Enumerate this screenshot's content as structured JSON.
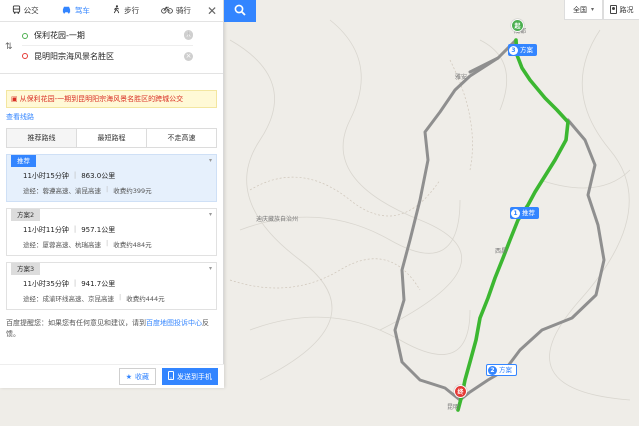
{
  "modes": {
    "transit": {
      "label": "公交",
      "icon": "bus-icon"
    },
    "drive": {
      "label": "驾车",
      "icon": "car-icon"
    },
    "walk": {
      "label": "步行",
      "icon": "walk-icon"
    },
    "bike": {
      "label": "骑行",
      "icon": "bike-icon"
    }
  },
  "origin": "保利花园-一期",
  "destination": "昆明阳宗海风景名胜区",
  "transit_notice": "从保利花园-一期到昆明阳宗海风景名胜区的跨城公交",
  "view_lines": "查看线路",
  "route_tabs": [
    "推荐路线",
    "最短路程",
    "不走高速"
  ],
  "plans": [
    {
      "tag": "推荐",
      "time": "11小时15分钟",
      "distance": "863.0公里",
      "via": "途经：蓉遵高速、渝昆高速",
      "toll": "收费约399元"
    },
    {
      "tag": "方案2",
      "time": "11小时11分钟",
      "distance": "957.1公里",
      "via": "途经：厦蓉高速、杭瑞高速",
      "toll": "收费约484元"
    },
    {
      "tag": "方案3",
      "time": "11小时35分钟",
      "distance": "941.7公里",
      "via": "途经：成渝环线高速、京昆高速",
      "toll": "收费约444元"
    }
  ],
  "tip": {
    "prefix": "百度提醒您：如果您有任何意见和建议，请到",
    "link": "百度地图投诉中心",
    "suffix": "反馈。"
  },
  "actions": {
    "favorite": "收藏",
    "send": "发送到手机"
  },
  "map": {
    "region": "全国",
    "traffic": "路况",
    "badges": {
      "plan3": "方案",
      "recommend": "推荐",
      "plan2": "方案"
    },
    "badge_nums": {
      "plan3": "3",
      "recommend": "1",
      "plan2": "2"
    },
    "start_marker": "起",
    "end_marker": "终",
    "labels": {
      "chengdu": "成都",
      "yaan": "雅安",
      "diqing": "迪庆藏族自治州",
      "xichang": "西昌",
      "kunming": "昆明"
    }
  },
  "colors": {
    "accent": "#3385ff",
    "route_recommended": "#3cb731",
    "route_alt": "#8f8f8f",
    "notice_text": "#d93025",
    "notice_bg": "#fff9d6"
  }
}
